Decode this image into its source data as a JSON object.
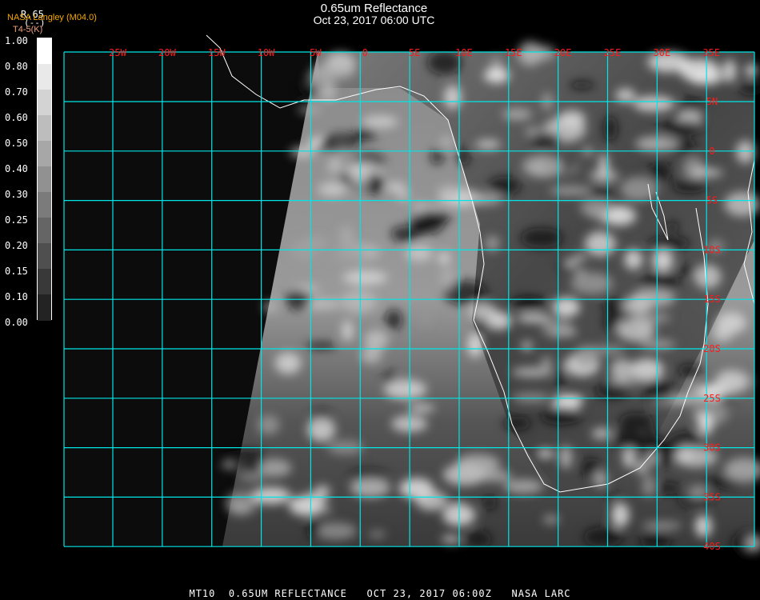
{
  "header": {
    "title": "0.65um Reflectance",
    "subtitle": "Oct 23, 2017 06:00 UTC"
  },
  "legend": {
    "producer": "NASA Langley (M04.0)",
    "variable": "R.65",
    "unit": "(--)",
    "secondary": "T4-5(K)",
    "ticks": [
      "1.00",
      "0.80",
      "0.70",
      "0.60",
      "0.50",
      "0.40",
      "0.30",
      "0.25",
      "0.20",
      "0.15",
      "0.10",
      "0.00"
    ]
  },
  "map": {
    "lon_labels": [
      "25W",
      "20W",
      "15W",
      "10W",
      "5W",
      "0",
      "5E",
      "10E",
      "15E",
      "20E",
      "25E",
      "30E",
      "35E"
    ],
    "lat_labels": [
      "5N",
      "0",
      "5S",
      "10S",
      "15S",
      "20S",
      "25S",
      "30S",
      "35S",
      "40S"
    ],
    "grid_color": "#00e5e5",
    "label_color": "#ff1a1a",
    "coast_color": "#ffffff"
  },
  "footer": {
    "text": "MT10  0.65UM REFLECTANCE   OCT 23, 2017 06:00Z   NASA LARC"
  }
}
